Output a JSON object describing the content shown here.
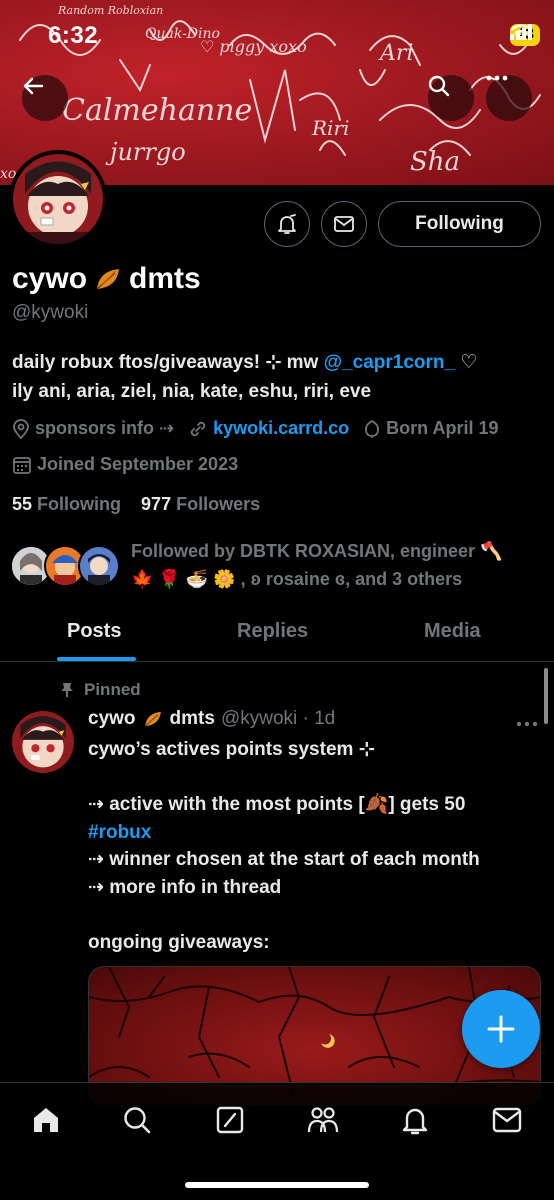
{
  "status_bar": {
    "time": "6:32",
    "battery": "43"
  },
  "banner": {
    "scribbles": [
      "Random Robloxian",
      "Calmehanne",
      "Quak-Dino",
      "xoxo",
      "jurrgo",
      "Riri",
      "Sha",
      "Ari"
    ]
  },
  "profile": {
    "name": "cywo",
    "name_suffix": "dmts",
    "handle": "@kywoki",
    "bio_line1_prefix": "daily robux ftos/giveaways! ⊹ mw ",
    "bio_mention": "@_capr1corn_",
    "bio_line1_suffix": " ♡",
    "bio_line2": "ily ani, aria, ziel, nia, kate, eshu, riri, eve",
    "sponsors": "sponsors info ⇢",
    "website": "kywoki.carrd.co",
    "born": "Born April 19",
    "joined": "Joined September 2023",
    "following_count": "55",
    "following_label": "Following",
    "followers_count": "977",
    "followers_label": "Followers",
    "followed_by_line1": "Followed by DBTK ROXASIAN, engineer 🪓",
    "followed_by_line2": "🍁 🌹 🍜 🌼 , ʚ rosaine ɞ, and 3 others"
  },
  "buttons": {
    "following": "Following"
  },
  "tabs": [
    {
      "label": "Posts"
    },
    {
      "label": "Replies"
    },
    {
      "label": "Media"
    }
  ],
  "post": {
    "pinned_label": "Pinned",
    "author": "cywo",
    "author_suffix": "dmts",
    "handle_time": "@kywoki · 1d",
    "lines": [
      "cywo’s actives points system ⊹",
      "",
      "⇢ active with the most points [🍂] gets 50",
      "#robux",
      "⇢ winner chosen at the start of each month",
      "⇢ more info in thread",
      "",
      "ongoing giveaways:"
    ]
  },
  "colors": {
    "accent": "#1d9bf0",
    "banner": "#b51c24",
    "background": "#000000",
    "muted": "#71767b"
  },
  "icons": [
    "back-icon",
    "search-icon",
    "more-icon",
    "notification-bell-icon",
    "message-icon",
    "location-icon",
    "link-icon",
    "birthday-icon",
    "calendar-icon",
    "pin-icon",
    "compose-plus-icon",
    "home-icon",
    "explore-icon",
    "grok-icon",
    "communities-icon",
    "notifications-icon",
    "messages-icon"
  ]
}
